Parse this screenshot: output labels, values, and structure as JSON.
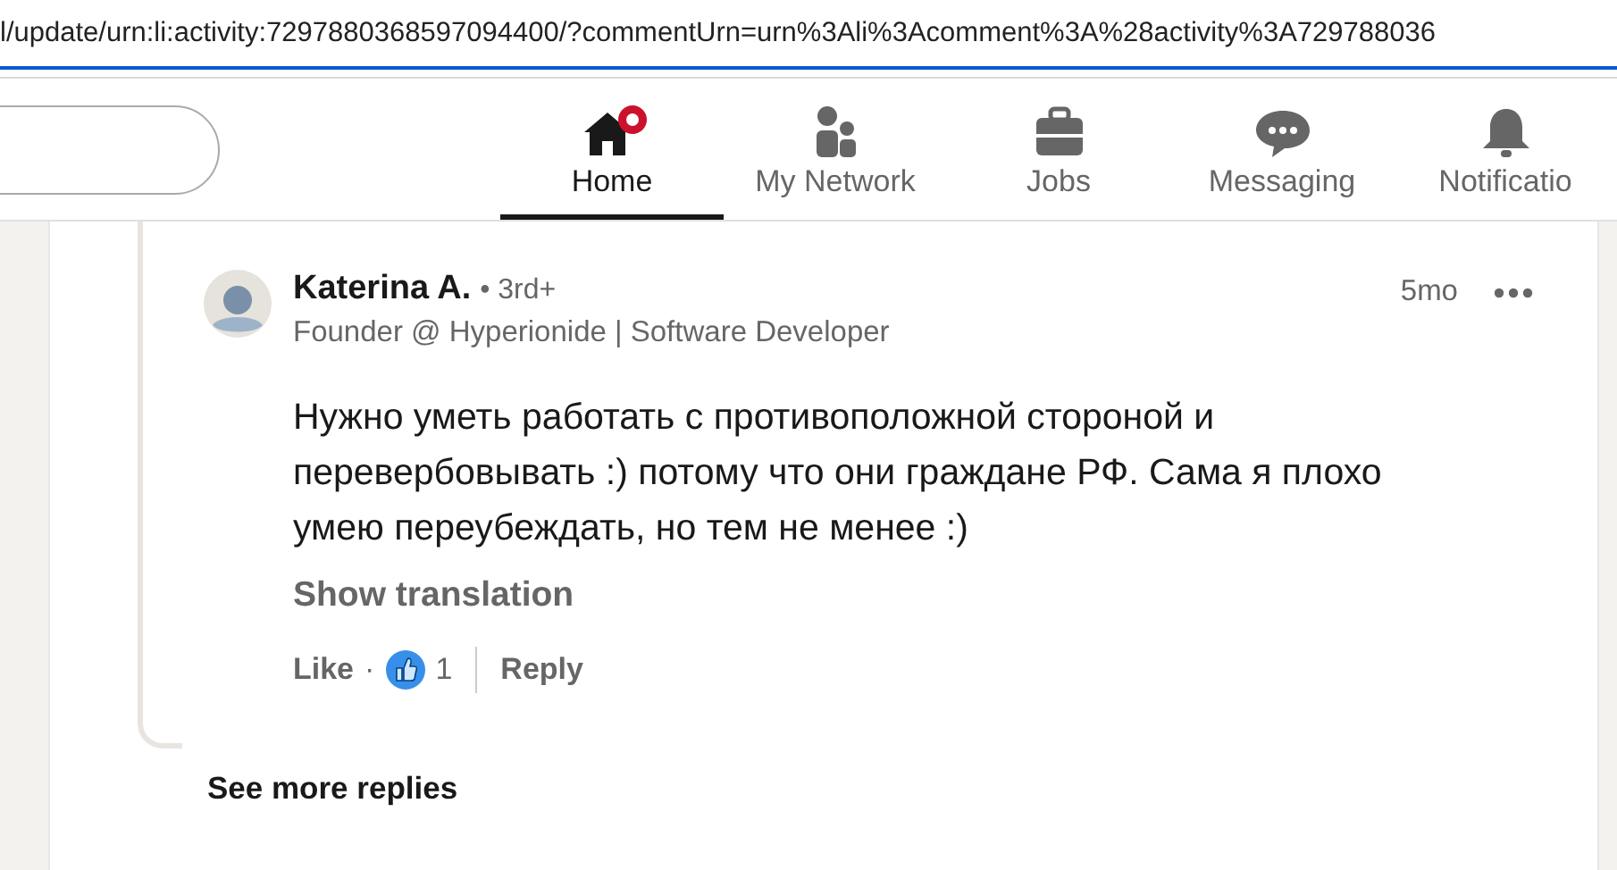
{
  "address_bar": {
    "url": "l/update/urn:li:activity:7297880368597094400/?commentUrn=urn%3Ali%3Acomment%3A%28activity%3A729788036"
  },
  "nav": {
    "tabs": [
      {
        "label": "Home",
        "selected": true
      },
      {
        "label": "My Network",
        "selected": false
      },
      {
        "label": "Jobs",
        "selected": false
      },
      {
        "label": "Messaging",
        "selected": false
      },
      {
        "label": "Notificatio",
        "selected": false
      }
    ]
  },
  "comment": {
    "author": "Katerina A.",
    "degree": "• 3rd+",
    "headline": "Founder @ Hyperionide | Software Developer",
    "time": "5mo",
    "text": "Нужно уметь работать с противоположной стороной и перевербовывать :) потому что они граждане РФ. Сама я плохо умею переубеждать, но тем не менее :)",
    "show_translation": "Show translation",
    "like": "Like",
    "separator": "·",
    "reaction_count": "1",
    "reply": "Reply"
  },
  "see_more_replies": "See more replies"
}
